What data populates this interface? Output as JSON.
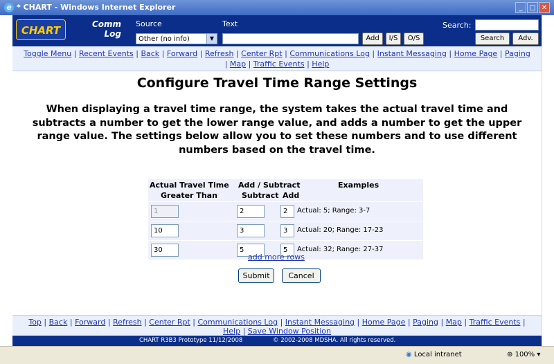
{
  "window": {
    "title": "* CHART - Windows Internet Explorer"
  },
  "header": {
    "logo_text": "CHART",
    "comm_log_line1": "Comm",
    "comm_log_line2": "Log",
    "source_label": "Source",
    "source_value": "Other (no info)",
    "text_label": "Text",
    "text_value": "",
    "add_label": "Add",
    "is_label": "I/S",
    "os_label": "O/S",
    "search_label": "Search:",
    "search_value": "",
    "search_button": "Search",
    "adv_button": "Adv."
  },
  "nav_links": {
    "toggle_menu": "Toggle Menu",
    "recent_events": "Recent Events",
    "back": "Back",
    "forward": "Forward",
    "refresh": "Refresh",
    "center_rpt": "Center Rpt",
    "communications_log": "Communications Log",
    "instant_messaging": "Instant Messaging",
    "home_page": "Home Page",
    "paging": "Paging",
    "map": "Map",
    "traffic_events": "Traffic Events",
    "help": "Help",
    "separator": "|"
  },
  "main": {
    "title": "Configure Travel Time Range Settings",
    "description": "When displaying a travel time range, the system takes the actual travel time and subtracts a number to get the lower range value, and adds a number to get the upper range value. The settings below allow you to set these numbers and to use different numbers based on the travel time."
  },
  "table": {
    "header_actual": "Actual Travel Time",
    "header_greater_than": "Greater Than",
    "header_add_subtract": "Add / Subtract",
    "header_subtract": "Subtract",
    "header_add": "Add",
    "header_examples": "Examples",
    "rows": [
      {
        "greater_than": "1",
        "subtract": "2",
        "add": "2",
        "example": "Actual: 5; Range: 3-7"
      },
      {
        "greater_than": "10",
        "subtract": "3",
        "add": "3",
        "example": "Actual: 20; Range: 17-23"
      },
      {
        "greater_than": "30",
        "subtract": "5",
        "add": "5",
        "example": "Actual: 32; Range: 27-37"
      }
    ],
    "add_more_rows": "add more rows"
  },
  "buttons": {
    "submit": "Submit",
    "cancel": "Cancel"
  },
  "footer": {
    "top": "Top",
    "back": "Back",
    "forward": "Forward",
    "refresh": "Refresh",
    "center_rpt": "Center Rpt",
    "communications_log": "Communications Log",
    "instant_messaging": "Instant Messaging",
    "home_page": "Home Page",
    "paging": "Paging",
    "map": "Map",
    "traffic_events": "Traffic Events",
    "help": "Help",
    "save_window_position": "Save Window Position",
    "version": "CHART R3B3 Prototype 11/12/2008",
    "copyright": "© 2002-2008 MDSHA. All rights reserved."
  },
  "statusbar": {
    "zone": "Local intranet",
    "zoom": "100%"
  }
}
